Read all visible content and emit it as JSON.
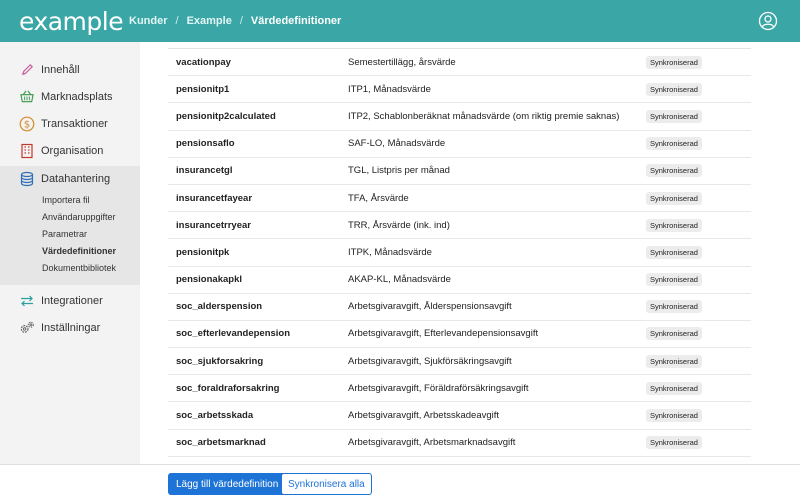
{
  "header": {
    "logo": "example",
    "breadcrumb": [
      "Kunder",
      "Example",
      "Värdedefinitioner"
    ]
  },
  "sidebar": {
    "items": [
      {
        "label": "Innehåll",
        "icon": "pencil-icon"
      },
      {
        "label": "Marknadsplats",
        "icon": "basket-icon"
      },
      {
        "label": "Transaktioner",
        "icon": "dollar-icon"
      },
      {
        "label": "Organisation",
        "icon": "building-icon"
      },
      {
        "label": "Datahantering",
        "icon": "database-icon"
      },
      {
        "label": "Integrationer",
        "icon": "arrows-icon"
      },
      {
        "label": "Inställningar",
        "icon": "gears-icon"
      }
    ],
    "subitems": [
      "Importera fil",
      "Användaruppgifter",
      "Parametrar",
      "Värdedefinitioner",
      "Dokumentbibliotek"
    ]
  },
  "table": {
    "rows": [
      {
        "name": "vacationpay",
        "desc": "Semestertillägg, årsvärde",
        "status": "Synkroniserad"
      },
      {
        "name": "pensionitp1",
        "desc": "ITP1, Månadsvärde",
        "status": "Synkroniserad"
      },
      {
        "name": "pensionitp2calculated",
        "desc": "ITP2, Schablonberäknat månadsvärde (om riktig premie saknas)",
        "status": "Synkroniserad"
      },
      {
        "name": "pensionsaflo",
        "desc": "SAF-LO, Månadsvärde",
        "status": "Synkroniserad"
      },
      {
        "name": "insurancetgl",
        "desc": "TGL, Listpris per månad",
        "status": "Synkroniserad"
      },
      {
        "name": "insurancetfayear",
        "desc": "TFA, Årsvärde",
        "status": "Synkroniserad"
      },
      {
        "name": "insurancetrryear",
        "desc": "TRR, Årsvärde (ink. ind)",
        "status": "Synkroniserad"
      },
      {
        "name": "pensionitpk",
        "desc": "ITPK, Månadsvärde",
        "status": "Synkroniserad"
      },
      {
        "name": "pensionakapkl",
        "desc": "AKAP-KL, Månadsvärde",
        "status": "Synkroniserad"
      },
      {
        "name": "soc_alderspension",
        "desc": "Arbetsgivaravgift, Ålderspensionsavgift",
        "status": "Synkroniserad"
      },
      {
        "name": "soc_efterlevandepension",
        "desc": "Arbetsgivaravgift, Efterlevandepensionsavgift",
        "status": "Synkroniserad"
      },
      {
        "name": "soc_sjukforsakring",
        "desc": "Arbetsgivaravgift, Sjukförsäkringsavgift",
        "status": "Synkroniserad"
      },
      {
        "name": "soc_foraldraforsakring",
        "desc": "Arbetsgivaravgift, Föräldraförsäkringsavgift",
        "status": "Synkroniserad"
      },
      {
        "name": "soc_arbetsskada",
        "desc": "Arbetsgivaravgift, Arbetsskadeavgift",
        "status": "Synkroniserad"
      },
      {
        "name": "soc_arbetsmarknad",
        "desc": "Arbetsgivaravgift, Arbetsmarknadsavgift",
        "status": "Synkroniserad"
      }
    ]
  },
  "footer": {
    "add_label": "Lägg till värdedefinition",
    "sync_label": "Synkronisera alla"
  },
  "colors": {
    "header": "#3aa6a6",
    "primary": "#1e73d6"
  }
}
